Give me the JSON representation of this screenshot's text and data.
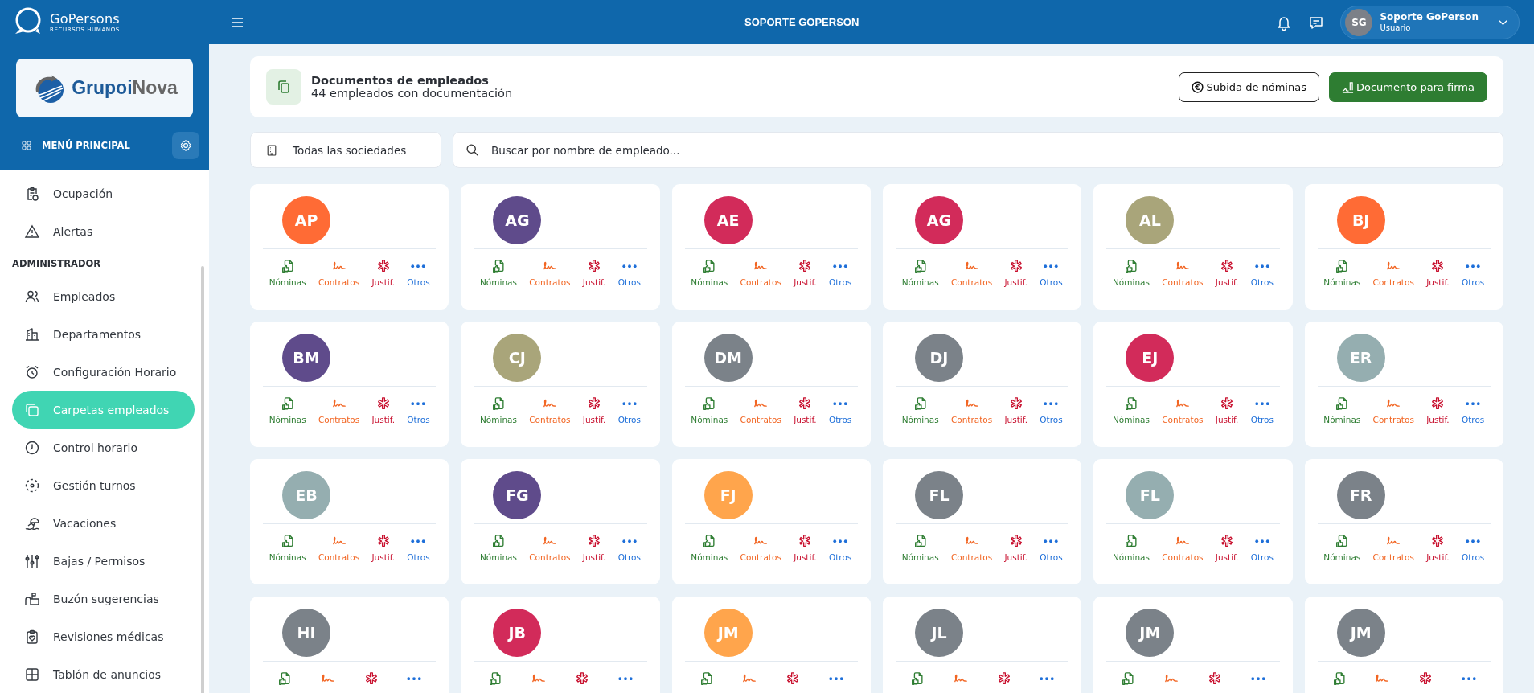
{
  "app": {
    "brand": "GoPersons",
    "tagline": "RECURSOS HUMANOS",
    "title": "SOPORTE GOPERSON"
  },
  "user": {
    "initials": "SG",
    "name": "Soporte GoPerson",
    "role": "Usuario"
  },
  "sidebar": {
    "company_logo": [
      "Grupoi",
      "Nova"
    ],
    "menu_label": "MENÚ PRINCIPAL",
    "items": [
      {
        "label": "Ocupación",
        "selected": false
      },
      {
        "label": "Alertas",
        "selected": false
      }
    ],
    "section": {
      "title": "ADMINISTRADOR",
      "items": [
        {
          "label": "Empleados",
          "selected": false
        },
        {
          "label": "Departamentos",
          "selected": false
        },
        {
          "label": "Configuración Horario",
          "selected": false
        },
        {
          "label": "Carpetas empleados",
          "selected": true
        },
        {
          "label": "Control horario",
          "selected": false
        },
        {
          "label": "Gestión turnos",
          "selected": false
        },
        {
          "label": "Vacaciones",
          "selected": false
        },
        {
          "label": "Bajas / Permisos",
          "selected": false
        },
        {
          "label": "Buzón sugerencias",
          "selected": false
        },
        {
          "label": "Revisiones médicas",
          "selected": false
        },
        {
          "label": "Tablón de anuncios",
          "selected": false
        }
      ]
    }
  },
  "page_header": {
    "title": "Documentos de empleados",
    "subtitle": "44 empleados con documentación",
    "buttons": [
      {
        "kind": "outline",
        "label": "Subida de nóminas"
      },
      {
        "kind": "primary",
        "label": "Documento para firma"
      }
    ]
  },
  "filters": {
    "company_filter": "Todas las sociedades",
    "search": {
      "placeholder": "Buscar por nombre de empleado..."
    }
  },
  "employees": [
    {
      "initials": "AP",
      "color": "#ff6b35",
      "actions": [
        {
          "kind": "payroll",
          "label": "Nóminas"
        },
        {
          "kind": "contract",
          "label": "Contratos"
        },
        {
          "kind": "justification",
          "label": "Justif."
        },
        {
          "kind": "other",
          "label": "Otros"
        }
      ]
    },
    {
      "initials": "AG",
      "color": "#5f4b8b",
      "actions": [
        {
          "kind": "payroll",
          "label": "Nóminas"
        },
        {
          "kind": "contract",
          "label": "Contratos"
        },
        {
          "kind": "justification",
          "label": "Justif."
        },
        {
          "kind": "other",
          "label": "Otros"
        }
      ]
    },
    {
      "initials": "AE",
      "color": "#d22b5a",
      "actions": [
        {
          "kind": "payroll",
          "label": "Nóminas"
        },
        {
          "kind": "contract",
          "label": "Contratos"
        },
        {
          "kind": "justification",
          "label": "Justif."
        },
        {
          "kind": "other",
          "label": "Otros"
        }
      ]
    },
    {
      "initials": "AG",
      "color": "#d22b5a",
      "actions": [
        {
          "kind": "payroll",
          "label": "Nóminas"
        },
        {
          "kind": "contract",
          "label": "Contratos"
        },
        {
          "kind": "justification",
          "label": "Justif."
        },
        {
          "kind": "other",
          "label": "Otros"
        }
      ]
    },
    {
      "initials": "AL",
      "color": "#a9a57a",
      "actions": [
        {
          "kind": "payroll",
          "label": "Nóminas"
        },
        {
          "kind": "contract",
          "label": "Contratos"
        },
        {
          "kind": "justification",
          "label": "Justif."
        },
        {
          "kind": "other",
          "label": "Otros"
        }
      ]
    },
    {
      "initials": "BJ",
      "color": "#ff6b35",
      "actions": [
        {
          "kind": "payroll",
          "label": "Nóminas"
        },
        {
          "kind": "contract",
          "label": "Contratos"
        },
        {
          "kind": "justification",
          "label": "Justif."
        },
        {
          "kind": "other",
          "label": "Otros"
        }
      ]
    },
    {
      "initials": "BM",
      "color": "#5f4b8b",
      "actions": [
        {
          "kind": "payroll",
          "label": "Nóminas"
        },
        {
          "kind": "contract",
          "label": "Contratos"
        },
        {
          "kind": "justification",
          "label": "Justif."
        },
        {
          "kind": "other",
          "label": "Otros"
        }
      ]
    },
    {
      "initials": "CJ",
      "color": "#a9a57a",
      "actions": [
        {
          "kind": "payroll",
          "label": "Nóminas"
        },
        {
          "kind": "contract",
          "label": "Contratos"
        },
        {
          "kind": "justification",
          "label": "Justif."
        },
        {
          "kind": "other",
          "label": "Otros"
        }
      ]
    },
    {
      "initials": "DM",
      "color": "#7b8289",
      "actions": [
        {
          "kind": "payroll",
          "label": "Nóminas"
        },
        {
          "kind": "contract",
          "label": "Contratos"
        },
        {
          "kind": "justification",
          "label": "Justif."
        },
        {
          "kind": "other",
          "label": "Otros"
        }
      ]
    },
    {
      "initials": "DJ",
      "color": "#7b8289",
      "actions": [
        {
          "kind": "payroll",
          "label": "Nóminas"
        },
        {
          "kind": "contract",
          "label": "Contratos"
        },
        {
          "kind": "justification",
          "label": "Justif."
        },
        {
          "kind": "other",
          "label": "Otros"
        }
      ]
    },
    {
      "initials": "EJ",
      "color": "#d22b5a",
      "actions": [
        {
          "kind": "payroll",
          "label": "Nóminas"
        },
        {
          "kind": "contract",
          "label": "Contratos"
        },
        {
          "kind": "justification",
          "label": "Justif."
        },
        {
          "kind": "other",
          "label": "Otros"
        }
      ]
    },
    {
      "initials": "ER",
      "color": "#95aeb0",
      "actions": [
        {
          "kind": "payroll",
          "label": "Nóminas"
        },
        {
          "kind": "contract",
          "label": "Contratos"
        },
        {
          "kind": "justification",
          "label": "Justif."
        },
        {
          "kind": "other",
          "label": "Otros"
        }
      ]
    },
    {
      "initials": "EB",
      "color": "#95aeb0",
      "actions": [
        {
          "kind": "payroll",
          "label": "Nóminas"
        },
        {
          "kind": "contract",
          "label": "Contratos"
        },
        {
          "kind": "justification",
          "label": "Justif."
        },
        {
          "kind": "other",
          "label": "Otros"
        }
      ]
    },
    {
      "initials": "FG",
      "color": "#5f4b8b",
      "actions": [
        {
          "kind": "payroll",
          "label": "Nóminas"
        },
        {
          "kind": "contract",
          "label": "Contratos"
        },
        {
          "kind": "justification",
          "label": "Justif."
        },
        {
          "kind": "other",
          "label": "Otros"
        }
      ]
    },
    {
      "initials": "FJ",
      "color": "#ffa54c",
      "actions": [
        {
          "kind": "payroll",
          "label": "Nóminas"
        },
        {
          "kind": "contract",
          "label": "Contratos"
        },
        {
          "kind": "justification",
          "label": "Justif."
        },
        {
          "kind": "other",
          "label": "Otros"
        }
      ]
    },
    {
      "initials": "FL",
      "color": "#7b8289",
      "actions": [
        {
          "kind": "payroll",
          "label": "Nóminas"
        },
        {
          "kind": "contract",
          "label": "Contratos"
        },
        {
          "kind": "justification",
          "label": "Justif."
        },
        {
          "kind": "other",
          "label": "Otros"
        }
      ]
    },
    {
      "initials": "FL",
      "color": "#95aeb0",
      "actions": [
        {
          "kind": "payroll",
          "label": "Nóminas"
        },
        {
          "kind": "contract",
          "label": "Contratos"
        },
        {
          "kind": "justification",
          "label": "Justif."
        },
        {
          "kind": "other",
          "label": "Otros"
        }
      ]
    },
    {
      "initials": "FR",
      "color": "#7b8289",
      "actions": [
        {
          "kind": "payroll",
          "label": "Nóminas"
        },
        {
          "kind": "contract",
          "label": "Contratos"
        },
        {
          "kind": "justification",
          "label": "Justif."
        },
        {
          "kind": "other",
          "label": "Otros"
        }
      ]
    },
    {
      "initials": "HI",
      "color": "#7b8289",
      "actions": [
        {
          "kind": "payroll"
        },
        {
          "kind": "contract"
        },
        {
          "kind": "justification"
        },
        {
          "kind": "other"
        }
      ]
    },
    {
      "initials": "JB",
      "color": "#d22b5a",
      "actions": [
        {
          "kind": "payroll"
        },
        {
          "kind": "contract"
        },
        {
          "kind": "justification"
        },
        {
          "kind": "other"
        }
      ]
    },
    {
      "initials": "JM",
      "color": "#ffa54c",
      "actions": [
        {
          "kind": "payroll"
        },
        {
          "kind": "contract"
        },
        {
          "kind": "justification"
        },
        {
          "kind": "other"
        }
      ]
    },
    {
      "initials": "JL",
      "color": "#7b8289",
      "actions": [
        {
          "kind": "payroll"
        },
        {
          "kind": "contract"
        },
        {
          "kind": "justification"
        },
        {
          "kind": "other"
        }
      ]
    },
    {
      "initials": "JM",
      "color": "#7b8289",
      "actions": [
        {
          "kind": "payroll"
        },
        {
          "kind": "contract"
        },
        {
          "kind": "justification"
        },
        {
          "kind": "other"
        }
      ]
    },
    {
      "initials": "JM",
      "color": "#7b8289",
      "actions": [
        {
          "kind": "payroll"
        },
        {
          "kind": "contract"
        },
        {
          "kind": "justification"
        },
        {
          "kind": "other"
        }
      ]
    }
  ]
}
